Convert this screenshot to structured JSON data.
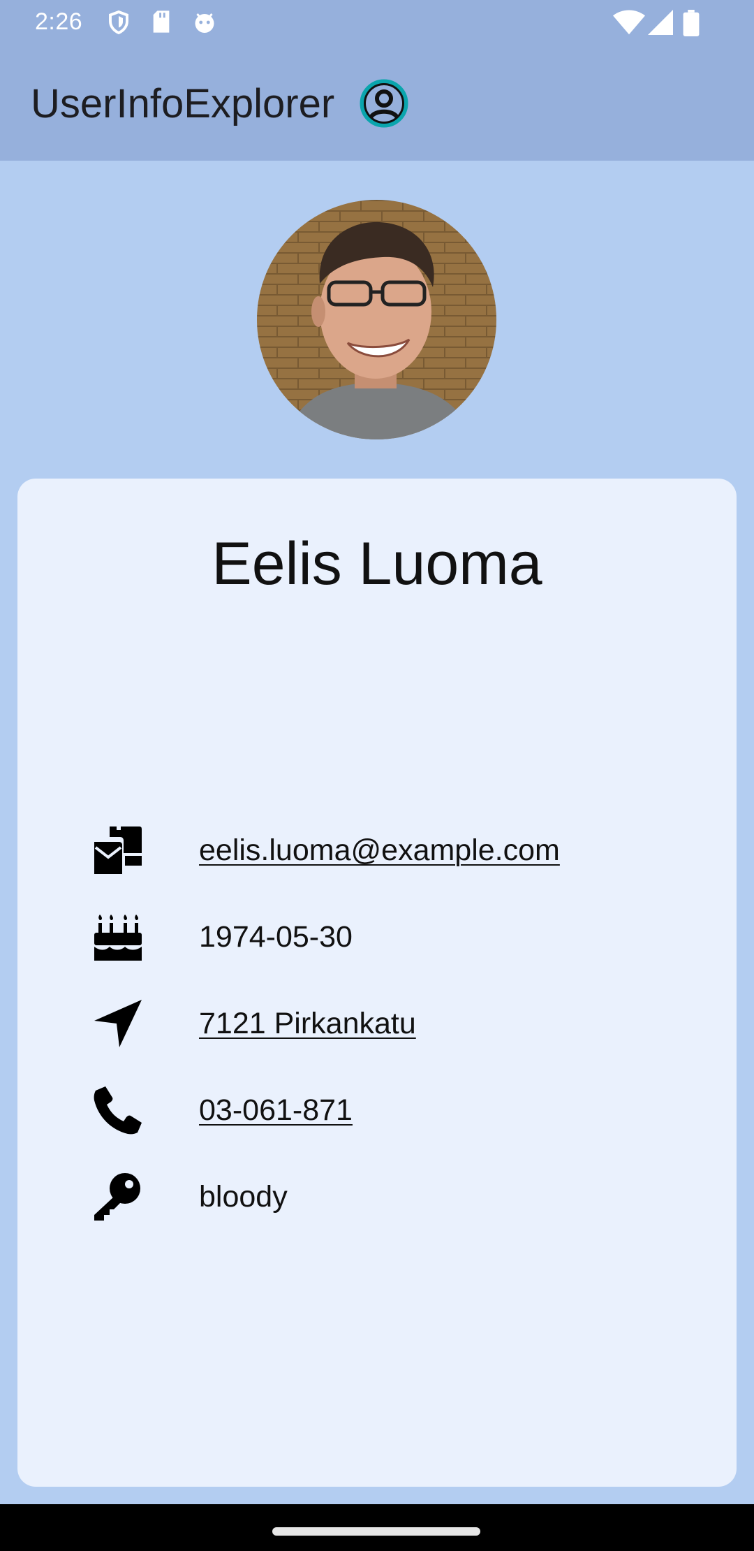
{
  "status_bar": {
    "time": "2:26",
    "left_icons": [
      "shield-icon",
      "sd-card-icon",
      "android-debug-icon"
    ],
    "right_icons": [
      "wifi-icon",
      "signal-icon",
      "battery-icon"
    ]
  },
  "app_bar": {
    "title": "UserInfoExplorer",
    "icon": "account-circle-icon",
    "icon_color": "#0aa5ad"
  },
  "profile": {
    "photo": "profile-photo",
    "name": "Eelis Luoma",
    "details": [
      {
        "icon": "mail-bulk-icon",
        "value": "eelis.luoma@example.com",
        "link": true
      },
      {
        "icon": "birthday-cake-icon",
        "value": "1974-05-30",
        "link": false
      },
      {
        "icon": "location-arrow-icon",
        "value": "7121 Pirkankatu",
        "link": true
      },
      {
        "icon": "phone-icon",
        "value": "03-061-871",
        "link": true
      },
      {
        "icon": "key-icon",
        "value": "bloody",
        "link": false
      }
    ]
  },
  "colors": {
    "background": "#b3cdf1",
    "app_bar": "#96b0dc",
    "card": "#eaf1fd"
  }
}
